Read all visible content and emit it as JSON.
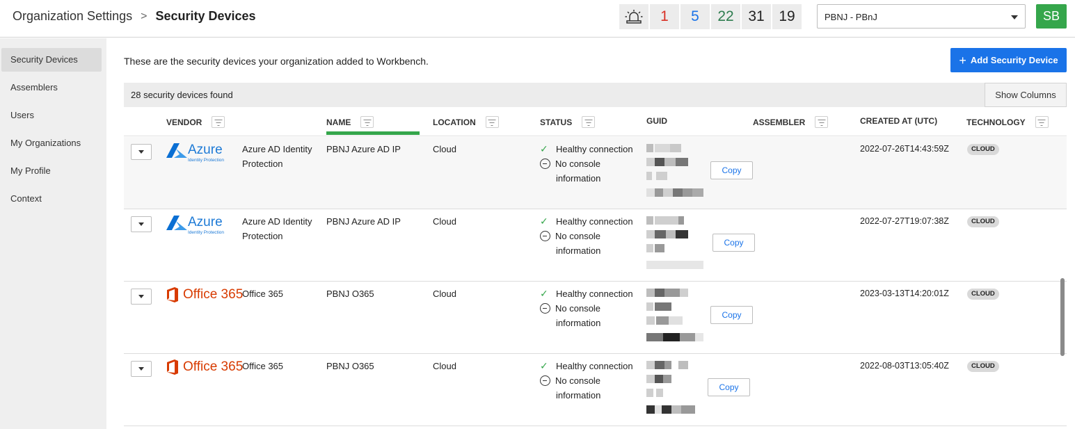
{
  "header": {
    "breadcrumb_root": "Organization Settings",
    "breadcrumb_separator": ">",
    "breadcrumb_current": "Security Devices",
    "alert_icon": "siren-icon",
    "alert_counts": [
      {
        "value": "1",
        "color": "#222222"
      },
      {
        "value": "5",
        "color": "#d93025"
      },
      {
        "value": "22",
        "color": "#e8710a"
      },
      {
        "value": "31",
        "color": "#1a73e8"
      },
      {
        "value": "19",
        "color": "#2e7d4f"
      }
    ],
    "org_selector_value": "PBNJ - PBnJ",
    "avatar_initials": "SB",
    "avatar_color": "#35a64b"
  },
  "sidebar": {
    "items": [
      {
        "label": "Security Devices",
        "active": true
      },
      {
        "label": "Assemblers",
        "active": false
      },
      {
        "label": "Users",
        "active": false
      },
      {
        "label": "My Organizations",
        "active": false
      },
      {
        "label": "My Profile",
        "active": false
      },
      {
        "label": "Context",
        "active": false
      }
    ]
  },
  "main": {
    "intro": "These are the security devices your organization added to Workbench.",
    "add_button": "Add Security Device",
    "found_text": "28 security devices found",
    "show_columns": "Show Columns",
    "columns": {
      "vendor": "VENDOR",
      "name": "NAME",
      "location": "LOCATION",
      "status": "STATUS",
      "guid": "GUID",
      "assembler": "ASSEMBLER",
      "created": "CREATED AT (UTC)",
      "technology": "TECHNOLOGY"
    },
    "rows": [
      {
        "vendor_logo": "azure-logo",
        "logo_text": "Azure",
        "logo_subtext": "Identity Protection",
        "product": "Azure AD Identity Protection",
        "name": "PBNJ Azure AD IP",
        "location": "Cloud",
        "status_ok": "Healthy connection",
        "status_console_1": "No console",
        "status_console_2": "information",
        "copy": "Copy",
        "created": "2022-07-26T14:43:59Z",
        "technology": "CLOUD"
      },
      {
        "vendor_logo": "azure-logo",
        "logo_text": "Azure",
        "logo_subtext": "Identity Protection",
        "product": "Azure AD Identity Protection",
        "name": "PBNJ Azure AD IP",
        "location": "Cloud",
        "status_ok": "Healthy connection",
        "status_console_1": "No console",
        "status_console_2": "information",
        "copy": "Copy",
        "created": "2022-07-27T19:07:38Z",
        "technology": "CLOUD"
      },
      {
        "vendor_logo": "office365-logo",
        "logo_text": "Office 365",
        "product": "Office 365",
        "name": "PBNJ O365",
        "location": "Cloud",
        "status_ok": "Healthy connection",
        "status_console_1": "No console",
        "status_console_2": "information",
        "copy": "Copy",
        "created": "2023-03-13T14:20:01Z",
        "technology": "CLOUD"
      },
      {
        "vendor_logo": "office365-logo",
        "logo_text": "Office 365",
        "product": "Office 365",
        "name": "PBNJ O365",
        "location": "Cloud",
        "status_ok": "Healthy connection",
        "status_console_1": "No console",
        "status_console_2": "information",
        "copy": "Copy",
        "created": "2022-08-03T13:05:40Z",
        "technology": "CLOUD"
      }
    ]
  }
}
